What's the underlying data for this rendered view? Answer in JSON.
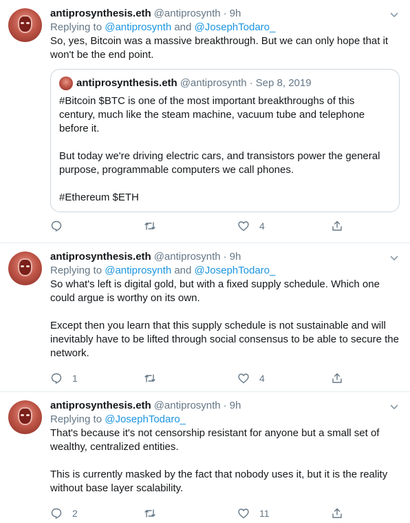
{
  "colors": {
    "link": "#1b95e0",
    "muted": "#657786",
    "border": "#e6ecf0"
  },
  "tweets": [
    {
      "name": "antiprosynthesis.eth",
      "handle": "@antiprosynth",
      "dot": "·",
      "time": "9h",
      "replying_prefix": "Replying to ",
      "replying_to": [
        "@antiprosynth",
        "@JosephTodaro_"
      ],
      "replying_join": " and ",
      "text": "So, yes, Bitcoin was a massive breakthrough. But we can only hope that it won't be the end point.",
      "quote": {
        "name": "antiprosynthesis.eth",
        "handle": "@antiprosynth",
        "dot": "·",
        "date": "Sep 8, 2019",
        "text": "#Bitcoin $BTC is one of the most important breakthroughs of this century, much like the steam machine, vacuum tube and telephone before it.\n\nBut today we're driving electric cars, and transistors power the general purpose, programmable computers we call phones.\n\n#Ethereum $ETH"
      },
      "replies": "",
      "retweets": "",
      "likes": "4"
    },
    {
      "name": "antiprosynthesis.eth",
      "handle": "@antiprosynth",
      "dot": "·",
      "time": "9h",
      "replying_prefix": "Replying to ",
      "replying_to": [
        "@antiprosynth",
        "@JosephTodaro_"
      ],
      "replying_join": " and ",
      "text": "So what's left is digital gold, but with a fixed supply schedule. Which one could argue is worthy on its own.\n\nExcept then you learn that this supply schedule is not sustainable and will inevitably have to be lifted through social consensus to be able to secure the network.",
      "replies": "1",
      "retweets": "",
      "likes": "4"
    },
    {
      "name": "antiprosynthesis.eth",
      "handle": "@antiprosynth",
      "dot": "·",
      "time": "9h",
      "replying_prefix": "Replying to ",
      "replying_to": [
        "@JosephTodaro_"
      ],
      "text": "That's because it's not censorship resistant for anyone but a small set of wealthy, centralized entities.\n\nThis is currently masked by the fact that nobody uses it, but it is the reality without base layer scalability.",
      "replies": "2",
      "retweets": "",
      "likes": "11"
    }
  ],
  "icons": {
    "reply": "speech-bubble-icon",
    "retweet": "retweet-icon",
    "like": "heart-icon",
    "share": "share-upload-icon",
    "caret": "chevron-down-icon"
  }
}
